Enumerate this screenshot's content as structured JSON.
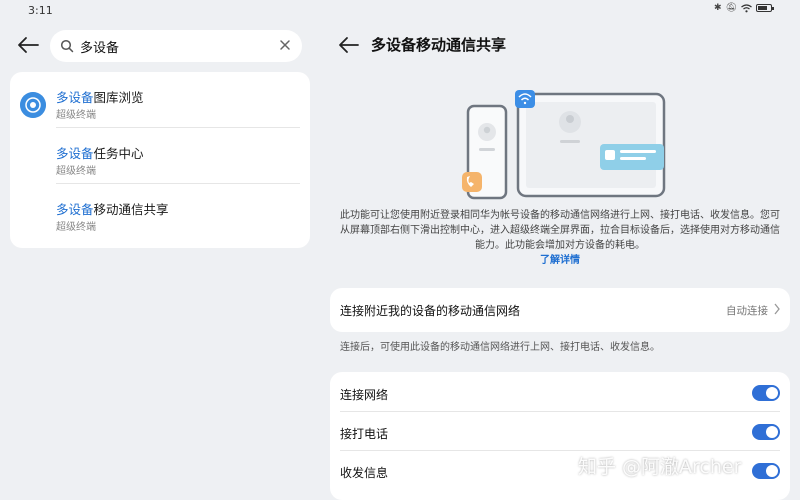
{
  "status_bar": {
    "time": "3:11",
    "icons": [
      "bluetooth-icon",
      "mute-icon",
      "wifi-icon",
      "battery-icon"
    ]
  },
  "search": {
    "query": "多设备",
    "results": [
      {
        "highlight": "多设备",
        "rest": "图库浏览",
        "subtitle": "超级终端",
        "icon": "gallery-app-icon"
      },
      {
        "highlight": "多设备",
        "rest": "任务中心",
        "subtitle": "超级终端"
      },
      {
        "highlight": "多设备",
        "rest": "移动通信共享",
        "subtitle": "超级终端"
      }
    ]
  },
  "detail": {
    "title": "多设备移动通信共享",
    "description": "此功能可让您使用附近登录相同华为帐号设备的移动通信网络进行上网、接打电话、收发信息。您可从屏幕顶部右侧下滑出控制中心，进入超级终端全屏界面，拉合目标设备后，选择使用对方移动通信能力。此功能会增加对方设备的耗电。",
    "learn_more": "了解详情",
    "connect_setting": {
      "label": "连接附近我的设备的移动通信网络",
      "value": "自动连接"
    },
    "connect_note": "连接后，可使用此设备的移动通信网络进行上网、接打电话、收发信息。",
    "toggles": [
      {
        "label": "连接网络",
        "on": true
      },
      {
        "label": "接打电话",
        "on": true
      },
      {
        "label": "收发信息",
        "on": true
      }
    ]
  },
  "watermark": "知乎 @阿澈Archer",
  "colors": {
    "accent": "#2f6fd6",
    "highlight": "#1f6fd1",
    "background": "#eef0f3"
  }
}
